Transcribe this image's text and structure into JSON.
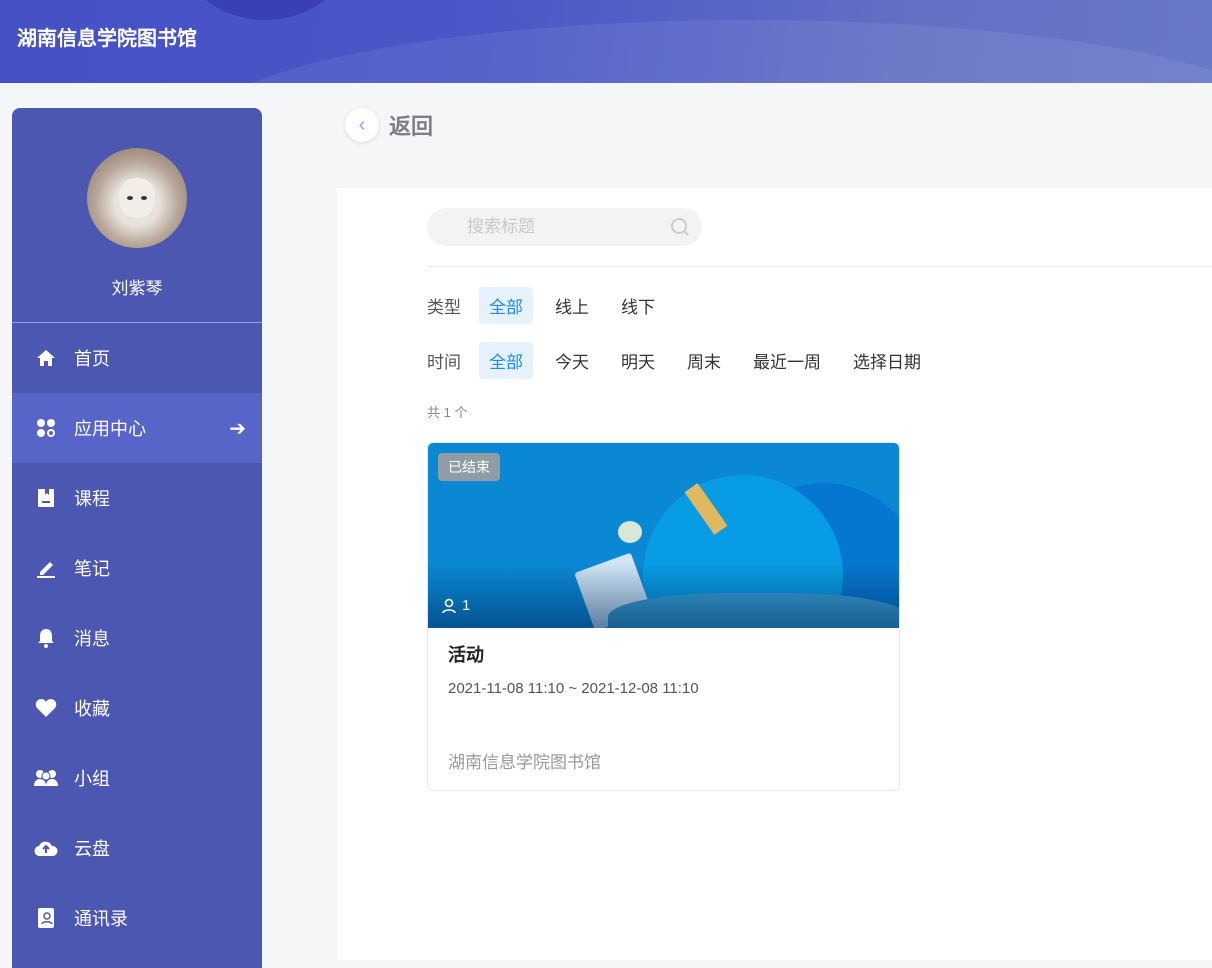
{
  "header": {
    "title": "湖南信息学院图书馆"
  },
  "user": {
    "name": "刘紫琴"
  },
  "sidebar": {
    "items": [
      {
        "label": "首页",
        "icon": "home-icon"
      },
      {
        "label": "应用中心",
        "icon": "apps-icon",
        "active": true
      },
      {
        "label": "课程",
        "icon": "book-icon"
      },
      {
        "label": "笔记",
        "icon": "pen-icon"
      },
      {
        "label": "消息",
        "icon": "bell-icon"
      },
      {
        "label": "收藏",
        "icon": "heart-icon"
      },
      {
        "label": "小组",
        "icon": "group-icon"
      },
      {
        "label": "云盘",
        "icon": "cloud-upload-icon"
      },
      {
        "label": "通讯录",
        "icon": "contacts-icon"
      }
    ]
  },
  "back": {
    "label": "返回"
  },
  "search": {
    "placeholder": "搜索标题",
    "value": ""
  },
  "filters": {
    "type": {
      "label": "类型",
      "options": [
        "全部",
        "线上",
        "线下"
      ],
      "selected": "全部"
    },
    "time": {
      "label": "时间",
      "options": [
        "全部",
        "今天",
        "明天",
        "周末",
        "最近一周",
        "选择日期"
      ],
      "selected": "全部"
    }
  },
  "count": "共 1 个",
  "cards": [
    {
      "status": "已结束",
      "participants": "1",
      "title": "活动",
      "date": "2021-11-08 11:10 ~ 2021-12-08 11:10",
      "org": "湖南信息学院图书馆"
    }
  ],
  "colors": {
    "sidebar": "#4c57b2",
    "active": "#5865c8",
    "accent": "#1d8af0"
  }
}
